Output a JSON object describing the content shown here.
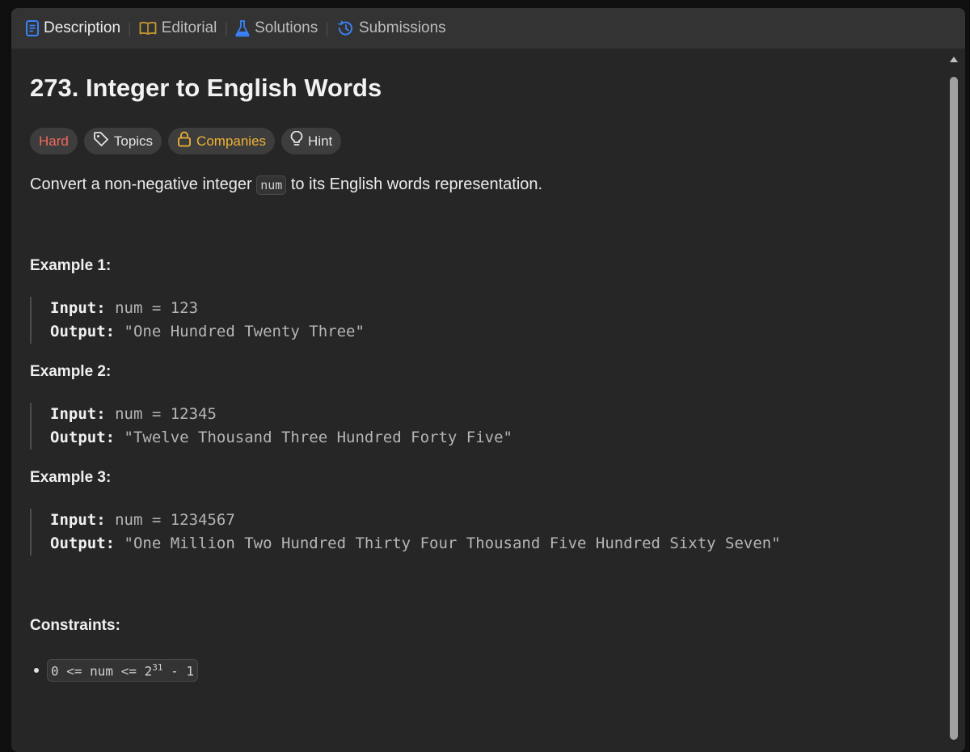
{
  "tabs": [
    {
      "label": "Description",
      "icon": "description-icon",
      "active": true,
      "color": "#3b82f6"
    },
    {
      "label": "Editorial",
      "icon": "book-icon",
      "active": false,
      "color": "#c79a2e"
    },
    {
      "label": "Solutions",
      "icon": "flask-icon",
      "active": false,
      "color": "#3b82f6"
    },
    {
      "label": "Submissions",
      "icon": "history-icon",
      "active": false,
      "color": "#3b82f6"
    }
  ],
  "problem": {
    "title": "273. Integer to English Words",
    "tags": {
      "difficulty": "Hard",
      "topics": "Topics",
      "companies": "Companies",
      "hint": "Hint"
    },
    "description_before": "Convert a non-negative integer ",
    "description_code": "num",
    "description_after": " to its English words representation.",
    "examples": [
      {
        "title": "Example 1:",
        "input_label": "Input:",
        "input": " num = 123",
        "output_label": "Output:",
        "output": " \"One Hundred Twenty Three\""
      },
      {
        "title": "Example 2:",
        "input_label": "Input:",
        "input": " num = 12345",
        "output_label": "Output:",
        "output": " \"Twelve Thousand Three Hundred Forty Five\""
      },
      {
        "title": "Example 3:",
        "input_label": "Input:",
        "input": " num = 1234567",
        "output_label": "Output:",
        "output": " \"One Million Two Hundred Thirty Four Thousand Five Hundred Sixty Seven\""
      }
    ],
    "constraints_title": "Constraints:",
    "constraint_base": "0 <= num <= 2",
    "constraint_exp": "31",
    "constraint_tail": " - 1"
  },
  "colors": {
    "hard": "#f2685e",
    "companies": "#f0b233",
    "panel_bg": "#262626",
    "tabbar_bg": "#333333"
  }
}
